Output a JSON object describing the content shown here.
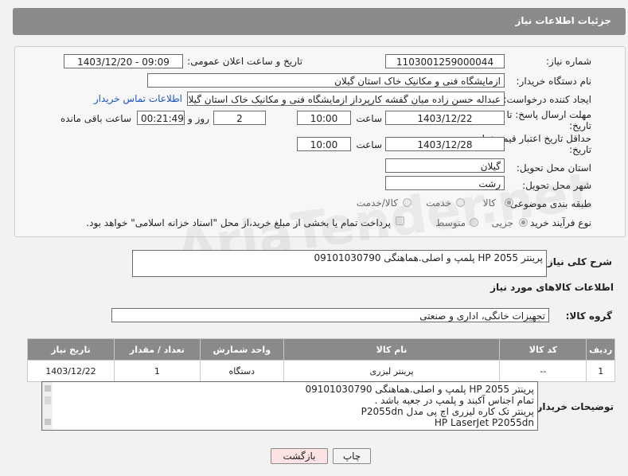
{
  "header": {
    "title": "جزئیات اطلاعات نیاز"
  },
  "colors": {
    "header_bg": "#8a8a8a",
    "link": "#1a55c4",
    "back_button_bg": "#fbe3e3"
  },
  "form": {
    "need_number": {
      "label": "شماره نیاز:",
      "value": "1103001259000044"
    },
    "announce_datetime": {
      "label": "تاریخ و ساعت اعلان عمومی:",
      "value": "1403/12/20 - 09:09"
    },
    "buyer_org": {
      "label": "نام دستگاه خریدار:",
      "value": "ازمایشگاه فنی و مکانیک خاک استان گیلان"
    },
    "requester": {
      "label": "ایجاد کننده درخواست:",
      "value": "عبداله حسن زاده میان گفشه کارپرداز ازمایشگاه فنی و مکانیک خاک استان گیلا"
    },
    "contact_link": "اطلاعات تماس خریدار",
    "reply_deadline": {
      "label_line1": "مهلت ارسال پاسخ: تا",
      "label_line2": "تاریخ:",
      "date": "1403/12/22",
      "time_label": "ساعت",
      "time": "10:00",
      "days": "2",
      "days_label": "روز و",
      "remaining": "00:21:49",
      "remaining_label": "ساعت باقی مانده"
    },
    "price_validity": {
      "label_line1": "حداقل تاریخ اعتبار قیمت: تا",
      "label_line2": "تاریخ:",
      "date": "1403/12/28",
      "time_label": "ساعت",
      "time": "10:00"
    },
    "delivery_province": {
      "label": "استان محل تحویل:",
      "value": "گیلان"
    },
    "delivery_city": {
      "label": "شهر محل تحویل:",
      "value": "رشت"
    },
    "category": {
      "label": "طبقه بندی موضوعی:",
      "options": [
        "کالا",
        "خدمت",
        "کالا/خدمت"
      ],
      "selected": "کالا"
    },
    "process_type": {
      "label": "نوع فرآیند خرید :",
      "options": [
        "جزیی",
        "متوسط"
      ],
      "selected": "جزیی",
      "payment_note": "پرداخت تمام یا بخشی از مبلغ خرید،از محل \"اسناد خزانه اسلامی\" خواهد بود."
    }
  },
  "description": {
    "label": "شرح کلی نیاز:",
    "value": "پرینتر HP 2055 پلمپ و اصلی.هماهنگی 09101030790"
  },
  "items_section": {
    "title": "اطلاعات کالاهای مورد نیاز",
    "group_label": "گروه کالا:",
    "group_value": "تجهیزات خانگی، اداری و صنعتی",
    "columns": [
      "ردیف",
      "کد کالا",
      "نام کالا",
      "واحد شمارش",
      "تعداد / مقدار",
      "تاریخ نیاز"
    ],
    "rows": [
      {
        "row": "1",
        "code": "--",
        "name": "پرینتر لیزری",
        "unit": "دستگاه",
        "qty": "1",
        "date": "1403/12/22"
      }
    ]
  },
  "buyer_notes": {
    "label": "توضیحات خریدار:",
    "lines": [
      "پرینتر HP 2055 پلمپ و اصلی.هماهنگی 09101030790",
      "تمام اجناس آکبند و پلمپ در جعبه باشد .",
      "پرینتر تک کاره لیزری اچ پی مدل P2055dn",
      "HP LaserJet P2055dn"
    ]
  },
  "buttons": {
    "print": "چاپ",
    "back": "بازگشت"
  }
}
